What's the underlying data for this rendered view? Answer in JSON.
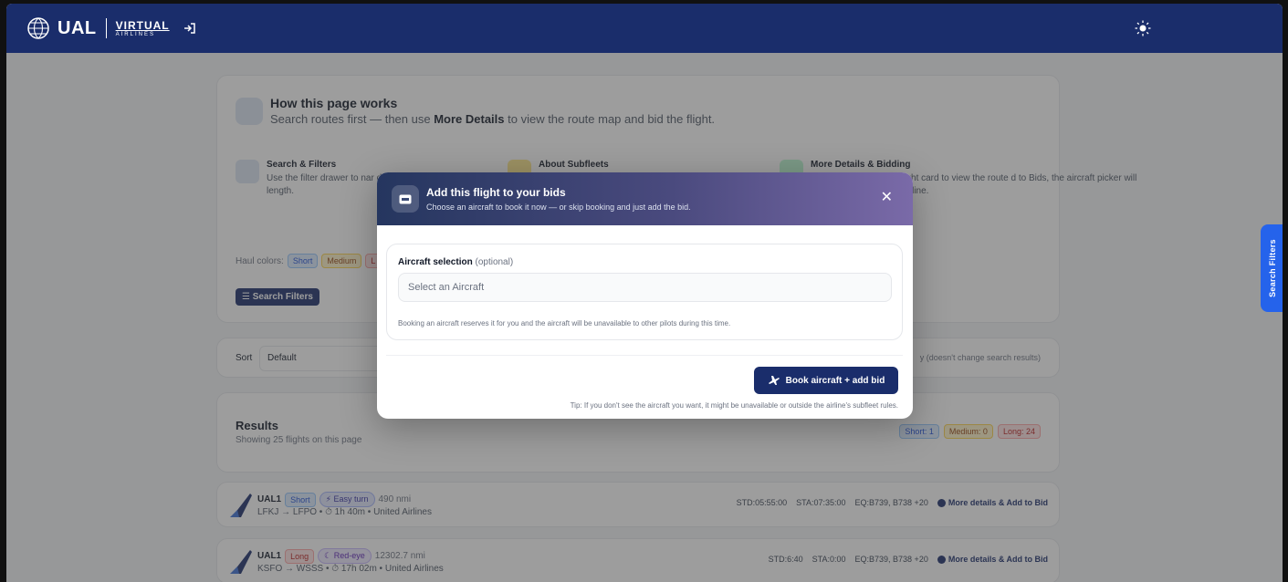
{
  "header": {
    "logo_text": "UAL",
    "logo_sub1": "VIRTUAL",
    "logo_sub2": "AIRLINES"
  },
  "how": {
    "title": "How this page works",
    "sub_pre": "Search routes first — then use ",
    "sub_bold": "More Details",
    "sub_post": " to view the route map and bid the flight.",
    "features": [
      {
        "title": "Search & Filters",
        "desc": "Use the filter drawer to nar departure/arrival, route co length."
      },
      {
        "title": "About Subfleets",
        "desc": ""
      },
      {
        "title": "More Details & Bidding",
        "desc": "light card to view the route d to Bids, the aircraft picker will airline."
      }
    ],
    "haul_label": "Haul colors:",
    "haul_short": "Short",
    "haul_medium": "Medium",
    "haul_long": "L",
    "search_filters_button": "Search Filters"
  },
  "sort": {
    "label": "Sort",
    "value": "Default",
    "note": "y (doesn't change search results)"
  },
  "results": {
    "title": "Results",
    "subtitle": "Showing 25 flights on this page",
    "counts": {
      "short": "Short: 1",
      "medium": "Medium: 0",
      "long": "Long: 24"
    }
  },
  "flights": [
    {
      "callsign": "UAL1",
      "haul": "Short",
      "tag": "Easy turn",
      "distance": "490 nmi",
      "route": "LFKJ → LFPO  •  ⏱ 1h 40m  •  United Airlines",
      "std": "STD:05:55:00",
      "sta": "STA:07:35:00",
      "eq": "EQ:B739, B738 +20",
      "action": "More details & Add to Bid"
    },
    {
      "callsign": "UAL1",
      "haul": "Long",
      "tag": "Red-eye",
      "distance": "12302.7 nmi",
      "route": "KSFO → WSSS  •  ⏱ 17h 02m  •  United Airlines",
      "std": "STD:6:40",
      "sta": "STA:0:00",
      "eq": "EQ:B739, B738 +20",
      "action": "More details & Add to Bid"
    }
  ],
  "side_tab": "Search Filters",
  "modal": {
    "title": "Add this flight to your bids",
    "subtitle": "Choose an aircraft to book it now — or skip booking and just add the bid.",
    "close": "✕",
    "selection_label": "Aircraft selection",
    "selection_optional": "(optional)",
    "select_placeholder": "Select an Aircraft",
    "booking_note": "Booking an aircraft reserves it for you and the aircraft will be unavailable to other pilots during this time.",
    "book_button": "Book aircraft + add bid",
    "tip": "Tip: If you don't see the aircraft you want, it might be unavailable or outside the airline's subfleet rules."
  },
  "colors": {
    "navy": "#1a2d6b",
    "side_tab": "#2563eb"
  }
}
